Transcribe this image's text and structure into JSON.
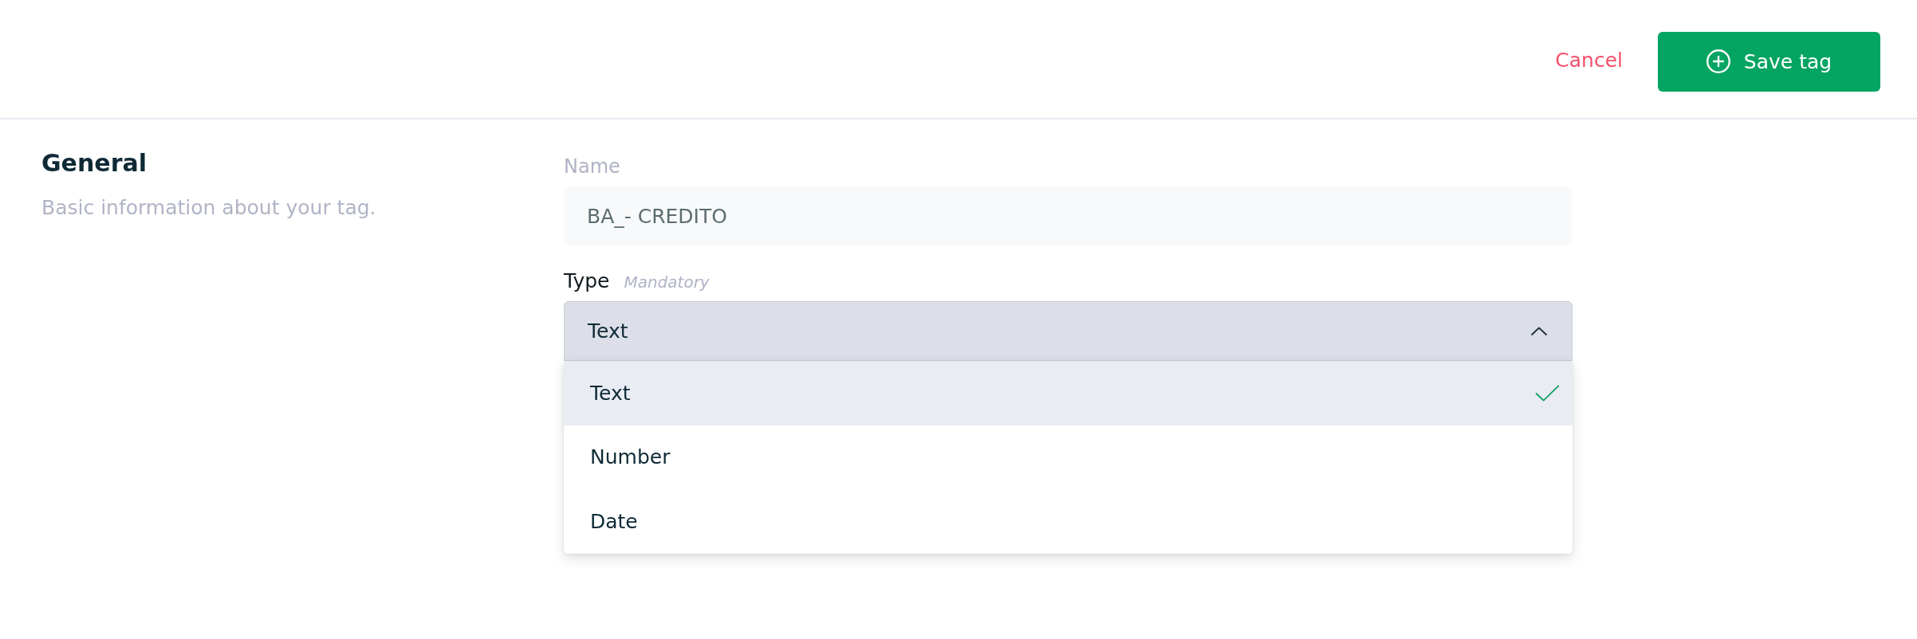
{
  "header": {
    "cancel_button": "Cancel",
    "save_button": "Save tag"
  },
  "section": {
    "title": "General",
    "description": "Basic information about your tag."
  },
  "fields": [
    {
      "kind": "text",
      "label": "Name",
      "value": "BA_- CREDITO"
    },
    {
      "kind": "select",
      "label": "Type",
      "hint": "Mandatory",
      "value": "Text",
      "expanded": true,
      "options": [
        {
          "label": "Text",
          "selected": true
        },
        {
          "label": "Number",
          "selected": false
        },
        {
          "label": "Date",
          "selected": false
        }
      ]
    }
  ]
}
